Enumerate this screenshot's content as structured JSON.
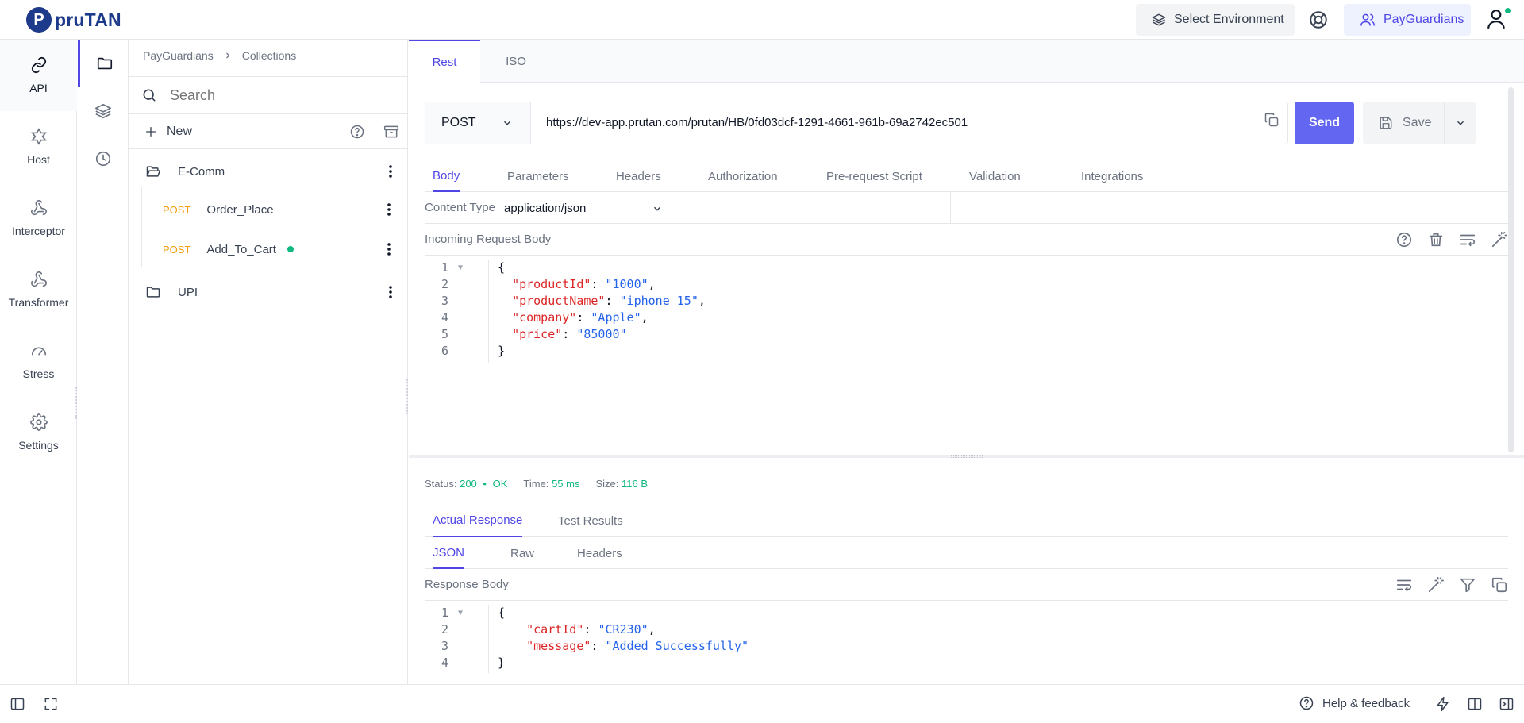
{
  "app": {
    "logo_text": "pruTAN",
    "logo_mark": "P"
  },
  "header": {
    "environment_label": "Select Environment",
    "org_label": "PayGuardians"
  },
  "leftnav": {
    "items": [
      {
        "label": "API",
        "icon": "link-icon",
        "active": true
      },
      {
        "label": "Host",
        "icon": "host-icon"
      },
      {
        "label": "Interceptor",
        "icon": "webhook-icon"
      },
      {
        "label": "Transformer",
        "icon": "webhook-icon"
      },
      {
        "label": "Stress",
        "icon": "gauge-icon"
      },
      {
        "label": "Settings",
        "icon": "gear-icon"
      }
    ]
  },
  "collections": {
    "breadcrumb": [
      "PayGuardians",
      "Collections"
    ],
    "search_placeholder": "Search",
    "new_label": "New",
    "tree": [
      {
        "type": "folder",
        "label": "E-Comm",
        "open": true
      },
      {
        "type": "request",
        "method": "POST",
        "label": "Order_Place"
      },
      {
        "type": "request",
        "method": "POST",
        "label": "Add_To_Cart",
        "unsaved": true
      },
      {
        "type": "folder",
        "label": "UPI",
        "open": false
      }
    ]
  },
  "main": {
    "top_tabs": [
      {
        "label": "Rest",
        "active": true
      },
      {
        "label": "ISO"
      }
    ],
    "request": {
      "method": "POST",
      "url": "https://dev-app.prutan.com/prutan/HB/0fd03dcf-1291-4661-961b-69a2742ec501",
      "send_label": "Send",
      "save_label": "Save"
    },
    "request_tabs": [
      {
        "label": "Body",
        "active": true
      },
      {
        "label": "Parameters"
      },
      {
        "label": "Headers"
      },
      {
        "label": "Authorization"
      },
      {
        "label": "Pre-request Script"
      },
      {
        "label": "Validation"
      },
      {
        "label": "Integrations"
      }
    ],
    "content_type_label": "Content Type",
    "content_type_value": "application/json",
    "request_body_label": "Incoming Request Body",
    "request_body_lines": [
      {
        "n": "1",
        "text": "{"
      },
      {
        "n": "2",
        "key": "\"productId\"",
        "val": "\"1000\"",
        "comma": ","
      },
      {
        "n": "3",
        "key": "\"productName\"",
        "val": "\"iphone 15\"",
        "comma": ","
      },
      {
        "n": "4",
        "key": "\"company\"",
        "val": "\"Apple\"",
        "comma": ","
      },
      {
        "n": "5",
        "key": "\"price\"",
        "val": "\"85000\"",
        "comma": ""
      },
      {
        "n": "6",
        "text": "}"
      }
    ],
    "response": {
      "status_label": "Status:",
      "status_code": "200",
      "status_sep": "•",
      "status_text": "OK",
      "time_label": "Time:",
      "time_value": "55 ms",
      "size_label": "Size:",
      "size_value": "116 B",
      "tabs": [
        {
          "label": "Actual Response",
          "active": true
        },
        {
          "label": "Test Results"
        }
      ],
      "sub_tabs": [
        {
          "label": "JSON",
          "active": true
        },
        {
          "label": "Raw"
        },
        {
          "label": "Headers"
        }
      ],
      "body_label": "Response Body",
      "body_lines": [
        {
          "n": "1",
          "text": "{"
        },
        {
          "n": "2",
          "key": "\"cartId\"",
          "val": "\"CR230\"",
          "comma": ","
        },
        {
          "n": "3",
          "key": "\"message\"",
          "val": "\"Added Successfully\"",
          "comma": ""
        },
        {
          "n": "4",
          "text": "}"
        }
      ]
    }
  },
  "footer": {
    "help_label": "Help & feedback"
  },
  "colors": {
    "accent": "#4f46e5",
    "send": "#6366f1",
    "post": "#f59e0b",
    "ok": "#10b981",
    "json_key": "#dc2626",
    "json_string": "#2563eb"
  }
}
